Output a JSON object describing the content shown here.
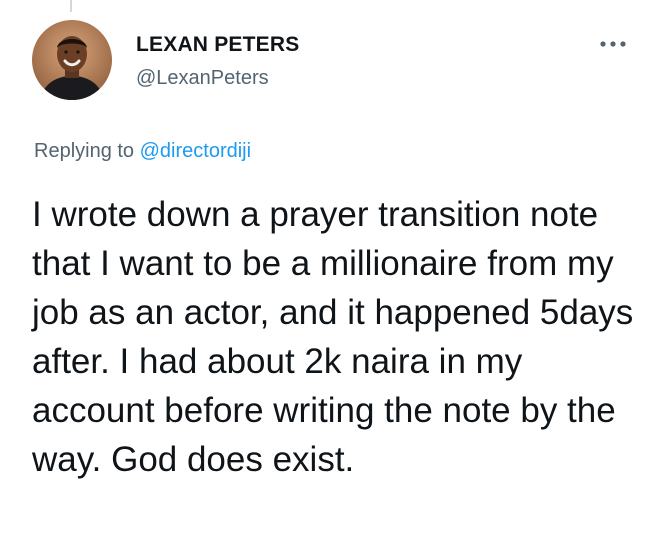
{
  "tweet": {
    "display_name": "LEXAN PETERS",
    "handle": "@LexanPeters",
    "replying_prefix": "Replying to",
    "replying_to": "@directordiji",
    "text": "I wrote down a prayer transition note that I want to be a millionaire from my job as an actor, and it happened 5days after. I had about 2k naira in my account before writing the note by the way. God does exist."
  },
  "icons": {
    "more": "more-horizontal-icon",
    "avatar": "user-avatar"
  },
  "colors": {
    "text_primary": "#0f1419",
    "text_secondary": "#536471",
    "link": "#1d9bf0"
  }
}
